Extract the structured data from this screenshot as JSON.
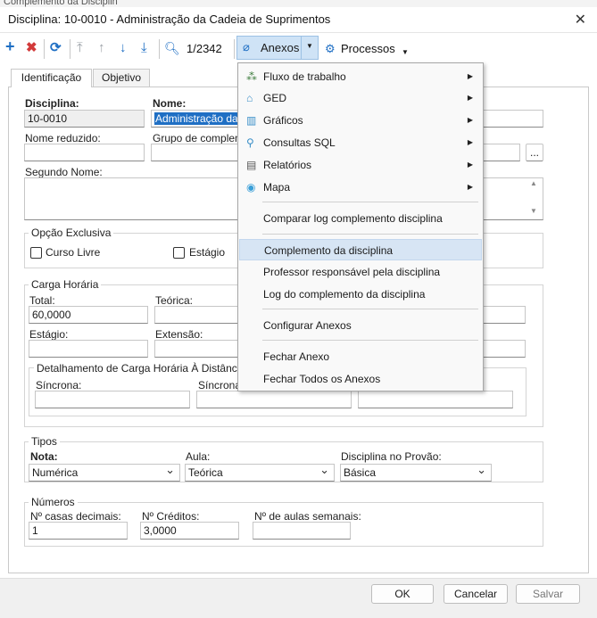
{
  "window": {
    "behind_title": "Complemento da Disciplin",
    "title": "Disciplina: 10-0010 - Administração da Cadeia de Suprimentos",
    "close_glyph": "✕"
  },
  "toolbar": {
    "record_counter": "1/2342",
    "anexos_label": "Anexos",
    "processos_label": "Processos"
  },
  "tabs": [
    {
      "label": "Identificação",
      "active": true
    },
    {
      "label": "Objetivo",
      "active": false
    }
  ],
  "identificacao": {
    "disciplina_label": "Disciplina:",
    "disciplina_value": "10-0010",
    "nome_label": "Nome:",
    "nome_value": "Administração da Ca",
    "nome_reduzido_label": "Nome reduzido:",
    "grupo_label": "Grupo de compleme",
    "segundo_nome_label": "Segundo Nome:",
    "ellipsis": "..."
  },
  "opcao_exclusiva": {
    "title": "Opção Exclusiva",
    "curso_livre": "Curso Livre",
    "estagio": "Estágio"
  },
  "carga_horaria": {
    "title": "Carga Horária",
    "total_label": "Total:",
    "total_value": "60,0000",
    "teorica_label": "Teórica:",
    "estagio_label": "Estágio:",
    "extensao_label": "Extensão:",
    "detalhamento_title": "Detalhamento de Carga Horária À Distância",
    "sincrona_label": "Síncrona:",
    "sincrona2_label": "Síncrona"
  },
  "tipos": {
    "title": "Tipos",
    "nota_label": "Nota:",
    "nota_value": "Numérica",
    "aula_label": "Aula:",
    "aula_value": "Teórica",
    "provao_label": "Disciplina no Provão:",
    "provao_value": "Básica"
  },
  "numeros": {
    "title": "Números",
    "casas_label": "Nº casas decimais:",
    "casas_value": "1",
    "creditos_label": "Nº Créditos:",
    "creditos_value": "3,0000",
    "aulas_label": "Nº de aulas semanais:"
  },
  "footer": {
    "ok": "OK",
    "cancelar": "Cancelar",
    "salvar": "Salvar"
  },
  "menu": {
    "items": [
      {
        "label": "Fluxo de trabalho",
        "icon": "workflow-icon",
        "submenu": true
      },
      {
        "label": "GED",
        "icon": "ged-icon",
        "submenu": true
      },
      {
        "label": "Gráficos",
        "icon": "chart-icon",
        "submenu": true
      },
      {
        "label": "Consultas SQL",
        "icon": "search-icon",
        "submenu": true
      },
      {
        "label": "Relatórios",
        "icon": "report-icon",
        "submenu": true
      },
      {
        "label": "Mapa",
        "icon": "map-pin-icon",
        "submenu": true
      },
      {
        "label": "Comparar log complemento disciplina"
      },
      {
        "label": "Complemento da disciplina",
        "highlighted": true
      },
      {
        "label": "Professor responsável pela disciplina"
      },
      {
        "label": "Log do complemento da disciplina"
      },
      {
        "label": "Configurar Anexos"
      },
      {
        "label": "Fechar Anexo"
      },
      {
        "label": "Fechar Todos os Anexos"
      }
    ]
  },
  "colors": {
    "accent_blue": "#1f6fc4",
    "delete_red": "#d23a3a",
    "menu_highlight": "#d7e5f4"
  }
}
